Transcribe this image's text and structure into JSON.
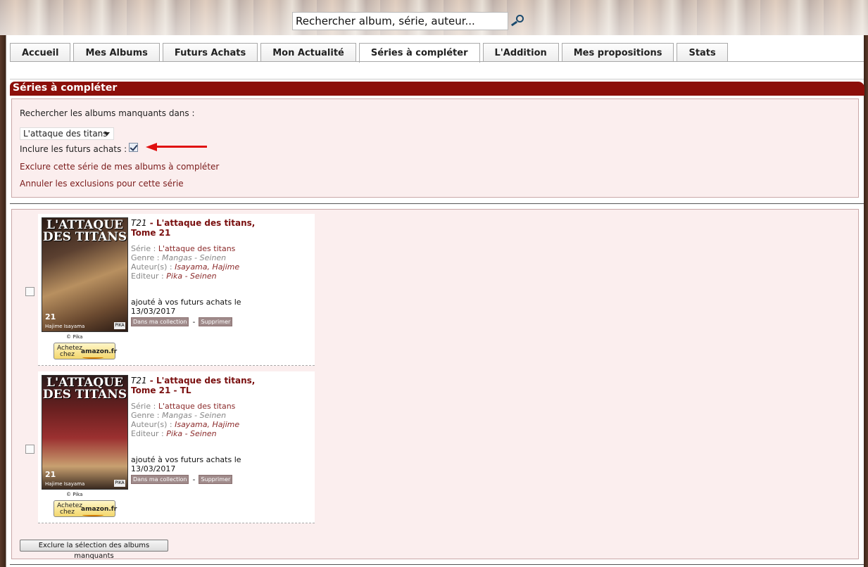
{
  "search": {
    "placeholder": "Rechercher album, série, auteur..."
  },
  "tabs": [
    {
      "label": "Accueil"
    },
    {
      "label": "Mes Albums"
    },
    {
      "label": "Futurs Achats"
    },
    {
      "label": "Mon Actualité"
    },
    {
      "label": "Séries à compléter",
      "active": true
    },
    {
      "label": "L'Addition"
    },
    {
      "label": "Mes propositions"
    },
    {
      "label": "Stats"
    }
  ],
  "section": {
    "title": "Séries à compléter",
    "search_label": "Rechercher les albums manquants dans :",
    "selected_series": "L'attaque des titans",
    "include_label": "Inclure les futurs achats :",
    "include_checked": true,
    "exclude_link": "Exclure cette série de mes albums à compléter",
    "cancel_link": "Annuler les exclusions pour cette série"
  },
  "albums": [
    {
      "tome_prefix": "T21",
      "title_line1": "L'attaque des titans,",
      "title_line2": "Tome 21",
      "serie_label": "Série :",
      "serie": "L'attaque des titans",
      "genre_label": "Genre :",
      "genre": "Mangas - Seinen",
      "auteur_label": "Auteur(s) :",
      "auteur": "Isayama, Hajime",
      "editeur_label": "Editeur :",
      "editeur": "Pika - Seinen",
      "added_line1": "ajouté à vos futurs achats le",
      "added_line2": "13/03/2017",
      "btn_collection": "Dans ma collection",
      "btn_delete": "Supprimer",
      "cover_title": "L'ATTAQUE DES TITANS",
      "cover_num": "21",
      "cover_author": "Hajime Isayama",
      "cover_pub": "PIKA",
      "copyright": "© Pika",
      "amazon_top": "Achetez",
      "amazon_bottom": "chez",
      "amazon_brand": "amazon.fr"
    },
    {
      "tome_prefix": "T21",
      "title_line1": "L'attaque des titans,",
      "title_line2": "Tome 21 - TL",
      "serie_label": "Série :",
      "serie": "L'attaque des titans",
      "genre_label": "Genre :",
      "genre": "Mangas - Seinen",
      "auteur_label": "Auteur(s) :",
      "auteur": "Isayama, Hajime",
      "editeur_label": "Editeur :",
      "editeur": "Pika - Seinen",
      "added_line1": "ajouté à vos futurs achats le",
      "added_line2": "13/03/2017",
      "btn_collection": "Dans ma collection",
      "btn_delete": "Supprimer",
      "cover_title": "L'ATTAQUE DES TITANS",
      "cover_num": "21",
      "cover_author": "Hajime Isayama",
      "cover_pub": "PIKA",
      "copyright": "© Pika",
      "amazon_top": "Achetez",
      "amazon_bottom": "chez",
      "amazon_brand": "amazon.fr"
    }
  ],
  "bulk_button": "Exclure la sélection des albums manquants"
}
